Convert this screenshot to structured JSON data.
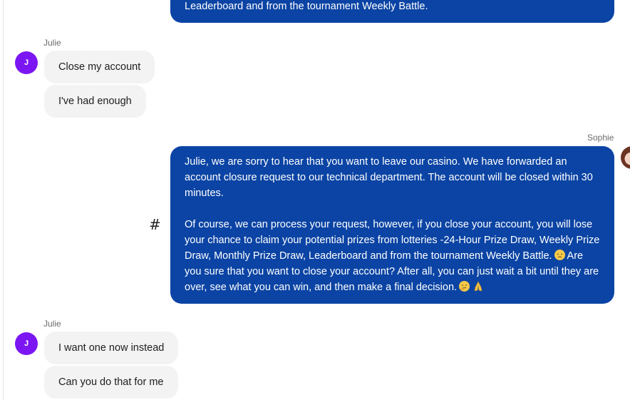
{
  "chat": {
    "top_partial": {
      "text": "Leaderboard and from the tournament Weekly Battle."
    },
    "group1": {
      "sender": "Julie",
      "avatar_initial": "J",
      "messages": [
        "Close my account",
        "I've had enough"
      ]
    },
    "agent_reply": {
      "sender": "Sophie",
      "hash_icon": "#",
      "paragraph1": "Julie, we are sorry to hear that you want to leave our casino. We have forwarded an account closure request to our technical department. The account will be closed within 30 minutes.",
      "paragraph2_part1": "Of course, we can process your request, however, if you close your account, you will lose your chance to claim your potential prizes from lotteries -24-Hour Prize Draw, Weekly Prize Draw, Monthly Prize Draw, Leaderboard and from the tournament Weekly Battle.",
      "paragraph2_part2": "Are you sure that you want to close your account? After all, you can just wait a bit until they are over, see what you can win, and then make a final decision."
    },
    "group2": {
      "sender": "Julie",
      "avatar_initial": "J",
      "messages": [
        "I want one now instead",
        "Can you do that for me"
      ]
    }
  },
  "colors": {
    "agent_bubble": "#0b44a4",
    "user_bubble": "#f3f3f4",
    "avatar": "#7b16f2"
  },
  "icons": [
    "hash-icon",
    "disappointed-face-emoji",
    "thinking-face-emoji",
    "folded-hands-emoji"
  ]
}
